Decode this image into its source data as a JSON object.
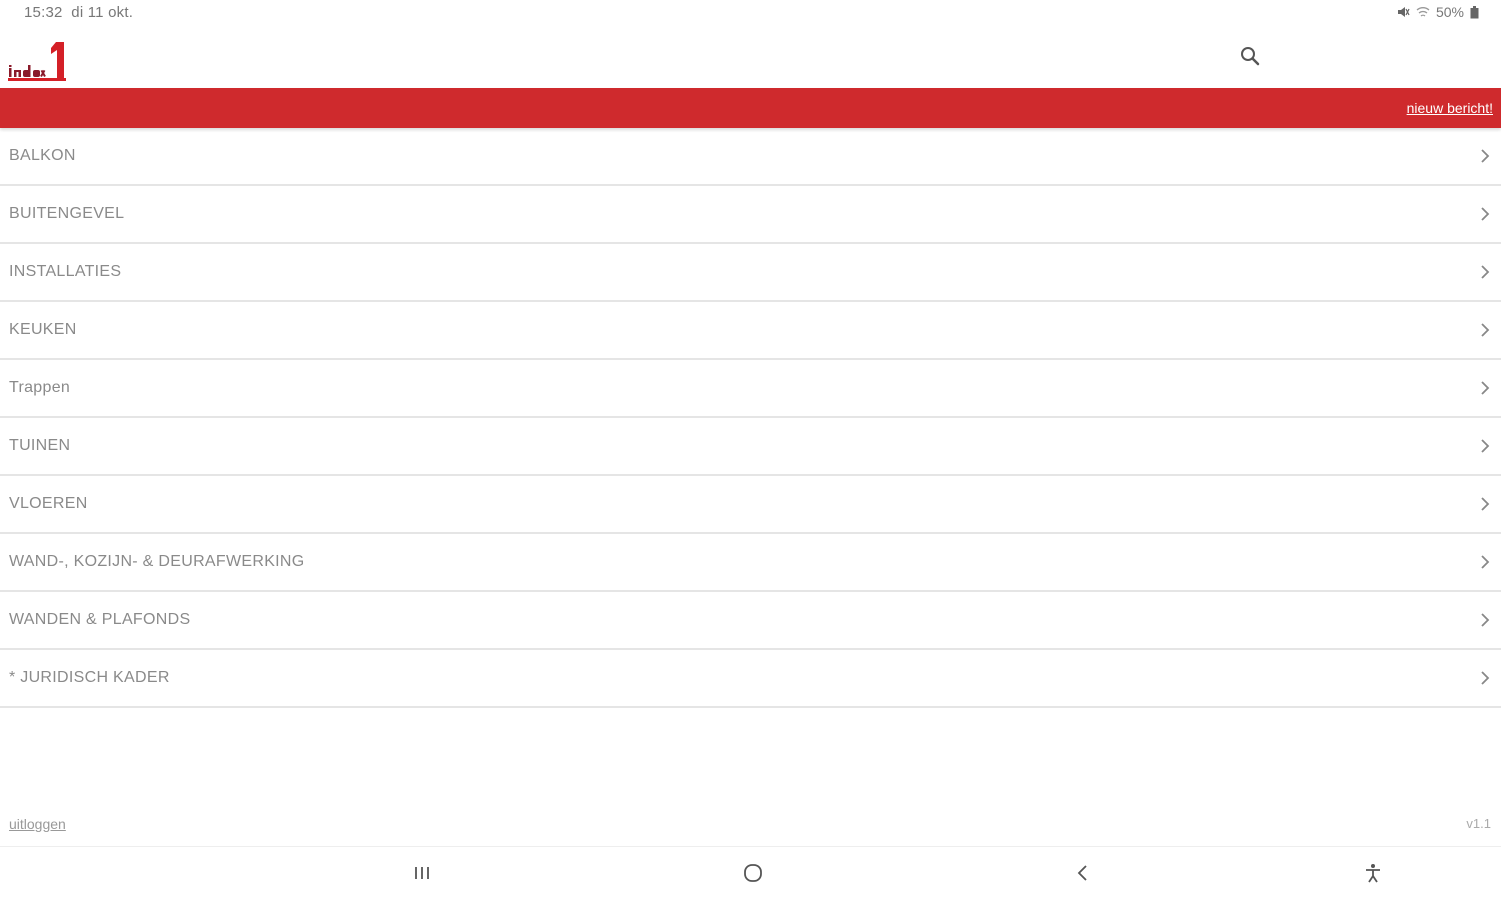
{
  "status_bar": {
    "time": "15:32",
    "date": "di 11 okt.",
    "battery": "50%"
  },
  "app_bar": {
    "logo_icon": "index1-logo",
    "search_icon": "search-icon"
  },
  "action_bar": {
    "new_message_label": "nieuw bericht!",
    "color": "#cf2a2d"
  },
  "menu": {
    "items": [
      {
        "label": "BALKON"
      },
      {
        "label": "BUITENGEVEL"
      },
      {
        "label": "INSTALLATIES"
      },
      {
        "label": "KEUKEN"
      },
      {
        "label": "Trappen"
      },
      {
        "label": "TUINEN"
      },
      {
        "label": "VLOEREN"
      },
      {
        "label": "WAND-, KOZIJN- & DEURAFWERKING"
      },
      {
        "label": "WANDEN & PLAFONDS"
      },
      {
        "label": "* JURIDISCH KADER"
      }
    ]
  },
  "footer": {
    "logout_label": "uitloggen",
    "version": "v1.1"
  },
  "system_nav": {
    "icons": [
      "recent-apps-icon",
      "home-icon",
      "back-icon",
      "accessibility-icon"
    ]
  }
}
